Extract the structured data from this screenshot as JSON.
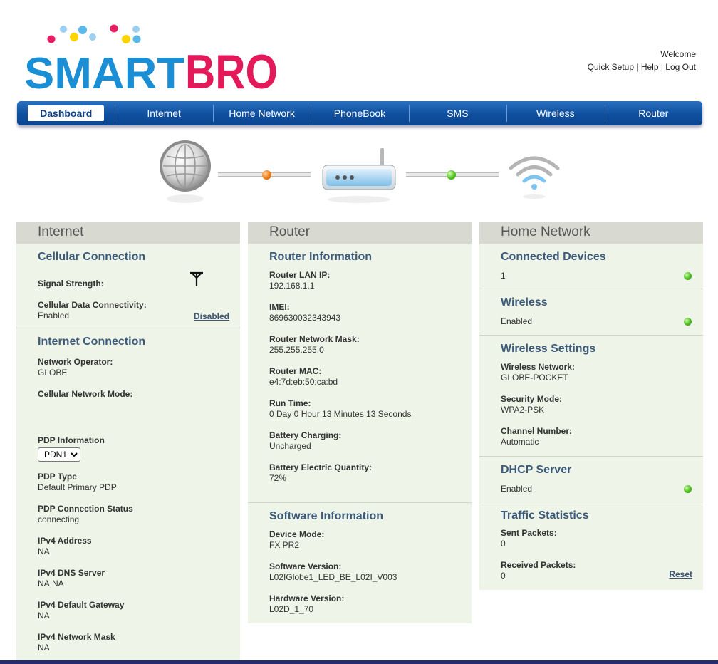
{
  "brand": {
    "logo_text_1": "SMART",
    "logo_text_2": "BRO"
  },
  "top_links": {
    "welcome": "Welcome",
    "quick_setup": "Quick Setup",
    "sep1": " | ",
    "help": "Help",
    "sep2": " | ",
    "logout": "Log Out"
  },
  "nav": [
    {
      "label": "Dashboard",
      "active": true
    },
    {
      "label": "Internet"
    },
    {
      "label": "Home Network"
    },
    {
      "label": "PhoneBook"
    },
    {
      "label": "SMS"
    },
    {
      "label": "Wireless"
    },
    {
      "label": "Router"
    }
  ],
  "status": {
    "internet_link": "orange",
    "wifi_link": "green"
  },
  "internet": {
    "header": "Internet",
    "cellular_title": "Cellular Connection",
    "signal_label": "Signal Strength:",
    "data_conn_label": "Cellular Data Connectivity:",
    "data_conn_value": "Enabled",
    "data_conn_action": "Disabled",
    "internet_title": "Internet Connection",
    "operator_label": "Network Operator:",
    "operator_value": "GLOBE",
    "mode_label": "Cellular Network Mode:",
    "mode_value": "",
    "pdp_label": "PDP Information",
    "pdp_selected": "PDN1",
    "pdp_type_label": "PDP Type",
    "pdp_type_value": "Default Primary PDP",
    "pdp_status_label": "PDP Connection Status",
    "pdp_status_value": "connecting",
    "ipv4_label": "IPv4 Address",
    "ipv4_value": "NA",
    "dns_label": "IPv4 DNS Server",
    "dns_value": "NA,NA",
    "gateway_label": "IPv4 Default Gateway",
    "gateway_value": "NA",
    "mask_label": "IPv4 Network Mask",
    "mask_value": "NA"
  },
  "router": {
    "header": "Router",
    "info_title": "Router Information",
    "lan_ip_label": "Router LAN IP:",
    "lan_ip_value": "192.168.1.1",
    "imei_label": "IMEI:",
    "imei_value": "869630032343943",
    "mask_label": "Router Network Mask:",
    "mask_value": "255.255.255.0",
    "mac_label": "Router MAC:",
    "mac_value": "e4:7d:eb:50:ca:bd",
    "runtime_label": "Run Time:",
    "runtime_value": "0 Day 0 Hour 13 Minutes 13 Seconds",
    "battery_label": "Battery Charging:",
    "battery_value": "Uncharged",
    "battery_qty_label": "Battery Electric Quantity:",
    "battery_qty_value": "72%",
    "sw_title": "Software Information",
    "device_mode_label": "Device Mode:",
    "device_mode_value": "FX PR2",
    "sw_version_label": "Software Version:",
    "sw_version_value": "L02IGlobe1_LED_BE_L02I_V003",
    "hw_version_label": "Hardware Version:",
    "hw_version_value": "L02D_1_70"
  },
  "home": {
    "header": "Home Network",
    "devices_title": "Connected Devices",
    "devices_value": "1",
    "wireless_title": "Wireless",
    "wireless_value": "Enabled",
    "ws_title": "Wireless Settings",
    "ssid_label": "Wireless Network:",
    "ssid_value": "GLOBE-POCKET",
    "security_label": "Security Mode:",
    "security_value": "WPA2-PSK",
    "channel_label": "Channel Number:",
    "channel_value": "Automatic",
    "dhcp_title": "DHCP Server",
    "dhcp_value": "Enabled",
    "traffic_title": "Traffic Statistics",
    "sent_label": "Sent Packets:",
    "sent_value": "0",
    "recv_label": "Received Packets:",
    "recv_value": "0",
    "reset_label": "Reset"
  },
  "colors": {
    "nav_bg": "#0f4f9e",
    "panel_bg": "#eef4e8",
    "panel_header": "#d8d9d1",
    "title": "#3c5a7a",
    "led_green": "#4cbb1a",
    "led_orange": "#f07b14"
  }
}
